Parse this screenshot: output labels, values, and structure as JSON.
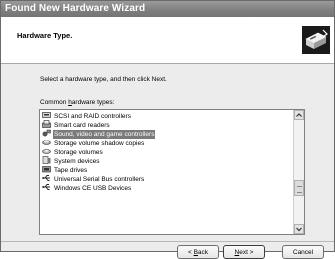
{
  "window": {
    "title": "Found New Hardware Wizard"
  },
  "header": {
    "title": "Hardware Type.",
    "icon": "hardware-wizard-icon"
  },
  "body": {
    "instruction": "Select a hardware type, and then click Next.",
    "list_label_pre": "Common ",
    "list_label_accel": "h",
    "list_label_post": "ardware types:"
  },
  "list": {
    "selected_index": 2,
    "items": [
      {
        "label": "SCSI and RAID controllers",
        "icon": "scsi-controller-icon"
      },
      {
        "label": "Smart card readers",
        "icon": "smart-card-reader-icon"
      },
      {
        "label": "Sound, video and game controllers",
        "icon": "sound-video-game-icon"
      },
      {
        "label": "Storage volume shadow copies",
        "icon": "storage-shadow-copy-icon"
      },
      {
        "label": "Storage volumes",
        "icon": "storage-volume-icon"
      },
      {
        "label": "System devices",
        "icon": "system-device-icon"
      },
      {
        "label": "Tape drives",
        "icon": "tape-drive-icon"
      },
      {
        "label": "Universal Serial Bus controllers",
        "icon": "usb-controller-icon"
      },
      {
        "label": "Windows CE USB Devices",
        "icon": "windows-ce-usb-icon"
      }
    ]
  },
  "buttons": {
    "back_pre": "< ",
    "back_accel": "B",
    "back_post": "ack",
    "next_accel": "N",
    "next_post": "ext >",
    "cancel": "Cancel"
  }
}
